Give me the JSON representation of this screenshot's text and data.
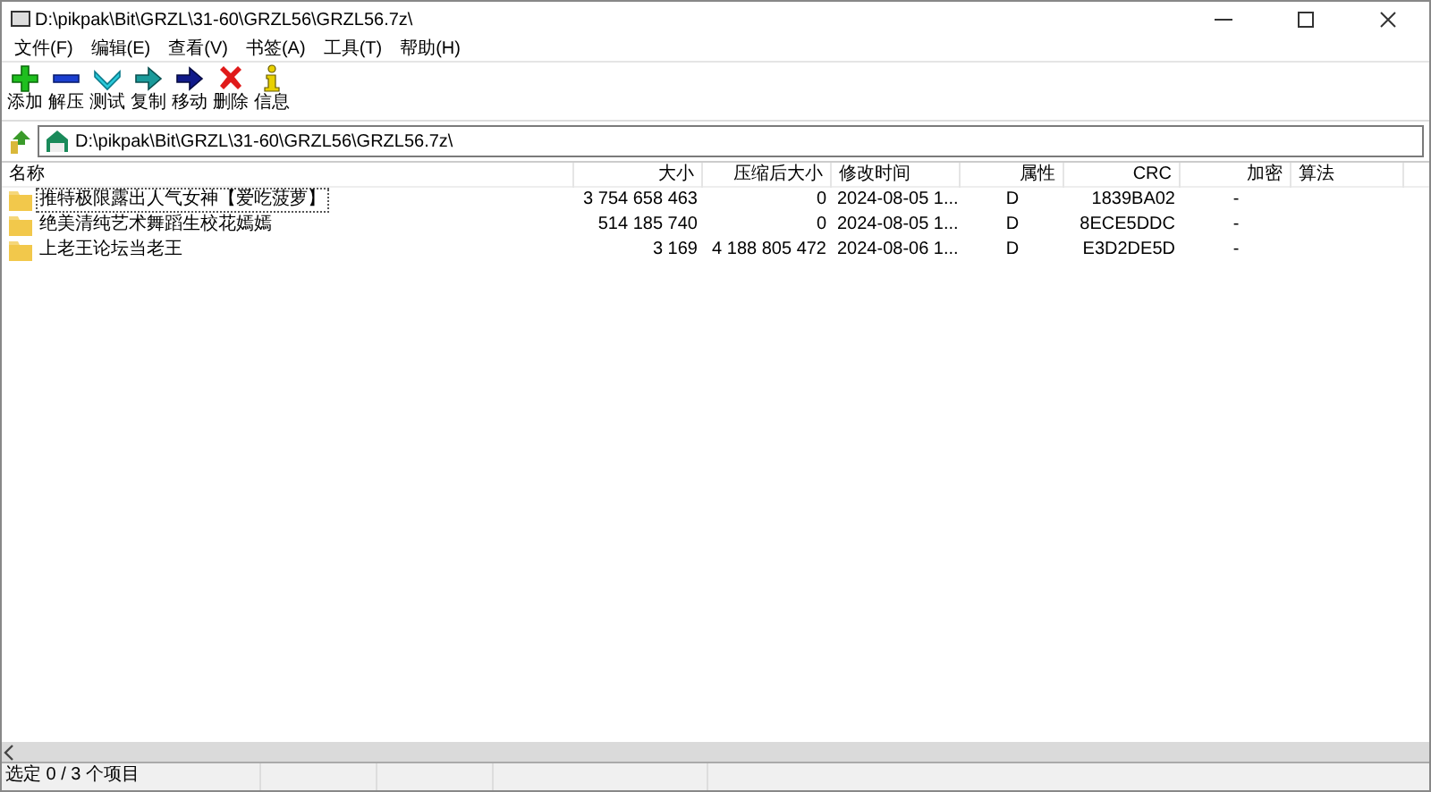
{
  "window": {
    "title": "D:\\pikpak\\Bit\\GRZL\\31-60\\GRZL56\\GRZL56.7z\\"
  },
  "menu": [
    "文件(F)",
    "编辑(E)",
    "查看(V)",
    "书签(A)",
    "工具(T)",
    "帮助(H)"
  ],
  "toolbar": [
    {
      "kind": "add",
      "label": "添加"
    },
    {
      "kind": "extract",
      "label": "解压"
    },
    {
      "kind": "test",
      "label": "测试"
    },
    {
      "kind": "copy",
      "label": "复制"
    },
    {
      "kind": "move",
      "label": "移动"
    },
    {
      "kind": "delete",
      "label": "删除"
    },
    {
      "kind": "info",
      "label": "信息"
    }
  ],
  "address": {
    "value": "D:\\pikpak\\Bit\\GRZL\\31-60\\GRZL56\\GRZL56.7z\\"
  },
  "table": {
    "columns": [
      "名称",
      "大小",
      "压缩后大小",
      "修改时间",
      "属性",
      "CRC",
      "加密",
      "算法"
    ],
    "rows": [
      {
        "focused": true,
        "cells": [
          "推特极限露出人气女神【爱吃菠萝】",
          "3 754 658 463",
          "0",
          "2024-08-05 1...",
          "D",
          "1839BA02",
          "-",
          ""
        ]
      },
      {
        "focused": false,
        "cells": [
          "绝美清纯艺术舞蹈生校花嫣嫣",
          "514 185 740",
          "0",
          "2024-08-05 1...",
          "D",
          "8ECE5DDC",
          "-",
          ""
        ]
      },
      {
        "focused": false,
        "cells": [
          "上老王论坛当老王",
          "3 169",
          "4 188 805 472",
          "2024-08-06 1...",
          "D",
          "E3D2DE5D",
          "-",
          ""
        ]
      }
    ]
  },
  "status_bar": {
    "text": "选定 0 / 3 个项目"
  }
}
